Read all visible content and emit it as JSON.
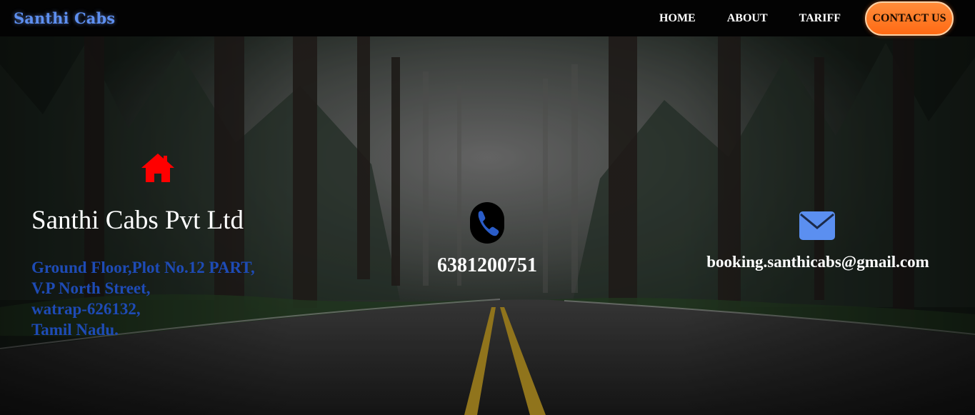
{
  "header": {
    "brand": "Santhi Cabs",
    "nav": [
      {
        "label": "HOME"
      },
      {
        "label": "ABOUT"
      },
      {
        "label": "TARIFF"
      }
    ],
    "cta_label": "CONTACT US"
  },
  "contact": {
    "company": "Santhi Cabs Pvt Ltd",
    "address_lines": [
      "Ground Floor,Plot No.12 PART,",
      "V.P North Street,",
      "watrap-626132,",
      "Tamil Nadu."
    ],
    "phone": "6381200751",
    "email": "booking.santhicabs@gmail.com"
  },
  "icons": {
    "home": "home-icon",
    "phone": "phone-icon",
    "mail": "envelope-icon"
  },
  "colors": {
    "brand": "#5d8ff0",
    "cta": "#ff7a22",
    "home_icon": "#ff0000",
    "mail_icon": "#5b8ff0",
    "address_text": "#1e4bb5"
  }
}
